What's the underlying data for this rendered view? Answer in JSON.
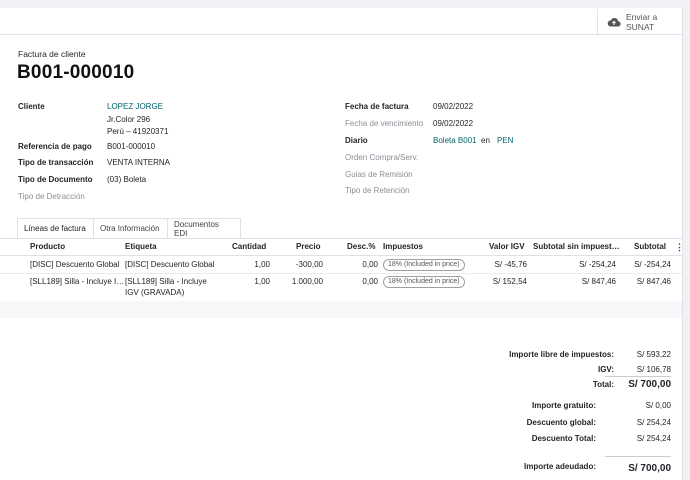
{
  "action": {
    "sunat_label": "Enviar a SUNAT",
    "sunat_line1": "Enviar a",
    "sunat_line2": "SUNAT",
    "icon": "cloud-upload-icon"
  },
  "header": {
    "doc_type": "Factura de cliente",
    "number": "B001-000010"
  },
  "left_fields": {
    "cliente_label": "Cliente",
    "cliente_name": "LOPEZ JORGE",
    "cliente_addr1": "Jr.Color 296",
    "cliente_addr2": "Perú – 41920371",
    "ref_label": "Referencia de pago",
    "ref_value": "B001-000010",
    "trans_label": "Tipo de transacción",
    "trans_value": "VENTA INTERNA",
    "tipodoc_label": "Tipo de Documento",
    "tipodoc_value": "(03) Boleta",
    "detraccion_label": "Tipo de Detracción"
  },
  "right_fields": {
    "fecha_label": "Fecha de factura",
    "fecha_value": "09/02/2022",
    "venc_label": "Fecha de vencimiento",
    "venc_value": "09/02/2022",
    "diario_label": "Diario",
    "diario_value": "Boleta B001",
    "diario_en": "en",
    "diario_currency": "PEN",
    "orden_label": "Orden Compra/Serv.",
    "guias_label": "Guias de Remisión",
    "retencion_label": "Tipo de Retención"
  },
  "tabs": [
    "Líneas de factura",
    "Otra Información",
    "Documentos EDI"
  ],
  "table": {
    "headers": [
      "Producto",
      "Etiqueta",
      "Cantidad",
      "Precio",
      "Desc.%",
      "Impuestos",
      "Valor IGV",
      "Subtotal sin impuest…",
      "Subtotal"
    ],
    "rows": [
      {
        "producto": "[DISC] Descuento Global",
        "etiqueta1": "[DISC] Descuento Global",
        "etiqueta2": "",
        "cantidad": "1,00",
        "precio": "-300,00",
        "desc": "0,00",
        "impuesto": "18% (Included in price)",
        "igv": "S/ -45,76",
        "subtotal_sin": "S/ -254,24",
        "subtotal": "S/ -254,24"
      },
      {
        "producto": "[SLL189] Silla - Incluye I…",
        "etiqueta1": "[SLL189] Silla - Incluye",
        "etiqueta2": "IGV (GRAVADA)",
        "cantidad": "1,00",
        "precio": "1.000,00",
        "desc": "0,00",
        "impuesto": "18% (Included in price)",
        "igv": "S/ 152,54",
        "subtotal_sin": "S/ 847,46",
        "subtotal": "S/ 847,46"
      }
    ]
  },
  "totals": {
    "libre_label": "Importe libre de impuestos:",
    "libre_value": "S/ 593,22",
    "igv_label": "IGV:",
    "igv_value": "S/ 106,78",
    "total_label": "Total:",
    "total_value": "S/ 700,00",
    "gratuito_label": "Importe gratuito:",
    "gratuito_value": "S/ 0,00",
    "descglobal_label": "Descuento global:",
    "descglobal_value": "S/ 254,24",
    "desctotal_label": "Descuento Total:",
    "desctotal_value": "S/ 254,24",
    "adeudado_label": "Importe adeudado:",
    "adeudado_value": "S/ 700,00"
  }
}
